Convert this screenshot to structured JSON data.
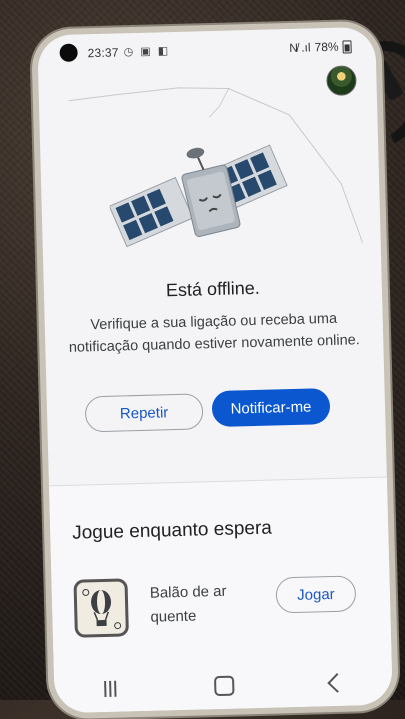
{
  "status_bar": {
    "time": "23:37",
    "left_icons": "◷ ▣ ◧",
    "signal": "N̸ .ıl",
    "battery_percent": "78%"
  },
  "offline": {
    "title": "Está offline.",
    "description": "Verifique a sua ligação ou receba uma notificação quando estiver novamente online.",
    "retry_label": "Repetir",
    "notify_label": "Notificar-me"
  },
  "games": {
    "section_title": "Jogue enquanto espera",
    "items": [
      {
        "name": "Balão de ar quente",
        "play_label": "Jogar",
        "icon": "hot-air-balloon-icon"
      }
    ]
  },
  "colors": {
    "primary": "#0b57d0",
    "link": "#1a56c4",
    "text": "#202124"
  }
}
